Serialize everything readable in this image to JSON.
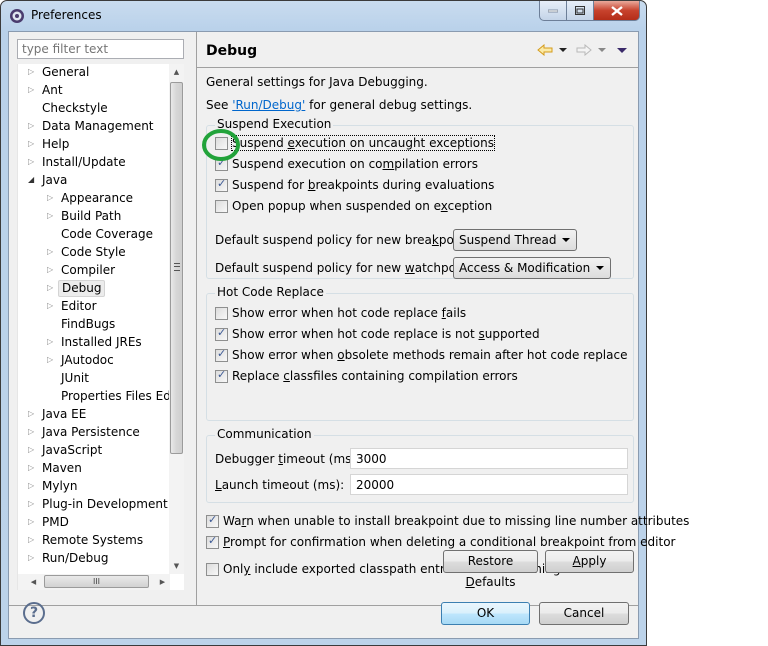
{
  "window": {
    "title": "Preferences",
    "icon": "gear-icon",
    "controls": {
      "minimize": "minimize-icon",
      "maximize": "maximize-icon",
      "close": "close-icon"
    }
  },
  "sidebar": {
    "filter_placeholder": "type filter text",
    "filter_value": "",
    "items": [
      {
        "label": "General",
        "level": 0,
        "expander": "collapsed"
      },
      {
        "label": "Ant",
        "level": 0,
        "expander": "collapsed"
      },
      {
        "label": "Checkstyle",
        "level": 0,
        "expander": "none"
      },
      {
        "label": "Data Management",
        "level": 0,
        "expander": "collapsed"
      },
      {
        "label": "Help",
        "level": 0,
        "expander": "collapsed"
      },
      {
        "label": "Install/Update",
        "level": 0,
        "expander": "collapsed"
      },
      {
        "label": "Java",
        "level": 0,
        "expander": "expanded"
      },
      {
        "label": "Appearance",
        "level": 1,
        "expander": "collapsed"
      },
      {
        "label": "Build Path",
        "level": 1,
        "expander": "collapsed"
      },
      {
        "label": "Code Coverage",
        "level": 1,
        "expander": "none"
      },
      {
        "label": "Code Style",
        "level": 1,
        "expander": "collapsed"
      },
      {
        "label": "Compiler",
        "level": 1,
        "expander": "collapsed"
      },
      {
        "label": "Debug",
        "level": 1,
        "expander": "collapsed",
        "selected": true
      },
      {
        "label": "Editor",
        "level": 1,
        "expander": "collapsed"
      },
      {
        "label": "FindBugs",
        "level": 1,
        "expander": "none"
      },
      {
        "label": "Installed JREs",
        "level": 1,
        "expander": "collapsed"
      },
      {
        "label": "JAutodoc",
        "level": 1,
        "expander": "collapsed"
      },
      {
        "label": "JUnit",
        "level": 1,
        "expander": "none"
      },
      {
        "label": "Properties Files Edito",
        "level": 1,
        "expander": "none"
      },
      {
        "label": "Java EE",
        "level": 0,
        "expander": "collapsed"
      },
      {
        "label": "Java Persistence",
        "level": 0,
        "expander": "collapsed"
      },
      {
        "label": "JavaScript",
        "level": 0,
        "expander": "collapsed"
      },
      {
        "label": "Maven",
        "level": 0,
        "expander": "collapsed"
      },
      {
        "label": "Mylyn",
        "level": 0,
        "expander": "collapsed"
      },
      {
        "label": "Plug-in Development",
        "level": 0,
        "expander": "collapsed"
      },
      {
        "label": "PMD",
        "level": 0,
        "expander": "collapsed"
      },
      {
        "label": "Remote Systems",
        "level": 0,
        "expander": "collapsed"
      },
      {
        "label": "Run/Debug",
        "level": 0,
        "expander": "collapsed"
      }
    ]
  },
  "page": {
    "title": "Debug",
    "nav": {
      "back": "back-arrow-icon",
      "forward": "forward-arrow-icon",
      "menu": "view-menu-icon"
    },
    "description": "General settings for Java Debugging.",
    "see_prefix": "See ",
    "see_link": "'Run/Debug'",
    "see_suffix": " for general debug settings.",
    "suspend_execution": {
      "title": "Suspend Execution",
      "options": [
        {
          "pre": "Suspend ",
          "mn": "e",
          "post": "xecution on uncaught exceptions",
          "checked": false,
          "focused": true
        },
        {
          "pre": "Suspend execution on co",
          "mn": "m",
          "post": "pilation errors",
          "checked": true
        },
        {
          "pre": "Suspend for ",
          "mn": "b",
          "post": "reakpoints during evaluations",
          "checked": true
        },
        {
          "pre": "Open popup when suspended on e",
          "mn": "x",
          "post": "ception",
          "checked": false
        }
      ],
      "breakpoint_policy": {
        "pre": "Default suspend policy for new brea",
        "mn": "k",
        "post": "points:",
        "value": "Suspend Thread"
      },
      "watchpoint_policy": {
        "pre": "Default suspend policy for new ",
        "mn": "w",
        "post": "atchpoints:",
        "value": "Access & Modification"
      }
    },
    "hot_code_replace": {
      "title": "Hot Code Replace",
      "options": [
        {
          "pre": "Show error when hot code replace ",
          "mn": "f",
          "post": "ails",
          "checked": false
        },
        {
          "pre": "Show error when hot code replace is not ",
          "mn": "s",
          "post": "upported",
          "checked": true
        },
        {
          "pre": "Show error when ",
          "mn": "o",
          "post": "bsolete methods remain after hot code replace",
          "checked": true
        },
        {
          "pre": "Replace ",
          "mn": "c",
          "post": "lassfiles containing compilation errors",
          "checked": true
        }
      ]
    },
    "communication": {
      "title": "Communication",
      "debugger_timeout": {
        "pre": "Debugger ",
        "mn": "t",
        "post": "imeout (ms):",
        "value": "3000"
      },
      "launch_timeout": {
        "pre": "",
        "mn": "L",
        "post": "aunch timeout (ms):",
        "value": "20000"
      }
    },
    "misc": [
      {
        "pre": "Wa",
        "mn": "r",
        "post": "n when unable to install breakpoint due to missing line number attributes",
        "checked": true
      },
      {
        "pre": "",
        "mn": "P",
        "post": "rompt for confirmation when deleting a conditional breakpoint from editor",
        "checked": true
      },
      {
        "pre": "Onl",
        "mn": "y",
        "post": " include exported classpath entries when launching",
        "checked": false
      }
    ],
    "restore_defaults": {
      "pre": "Restore ",
      "mn": "D",
      "post": "efaults"
    },
    "apply": {
      "pre": "",
      "mn": "A",
      "post": "pply"
    }
  },
  "footer": {
    "help_icon": "help-icon",
    "ok_label": "OK",
    "cancel_label": "Cancel"
  },
  "colors": {
    "link": "#0066cc",
    "highlight_circle": "#22a33a",
    "back_arrow": "#e8b637"
  },
  "annotation": {
    "type": "circle",
    "target": "suspend-uncaught-exceptions-checkbox"
  }
}
